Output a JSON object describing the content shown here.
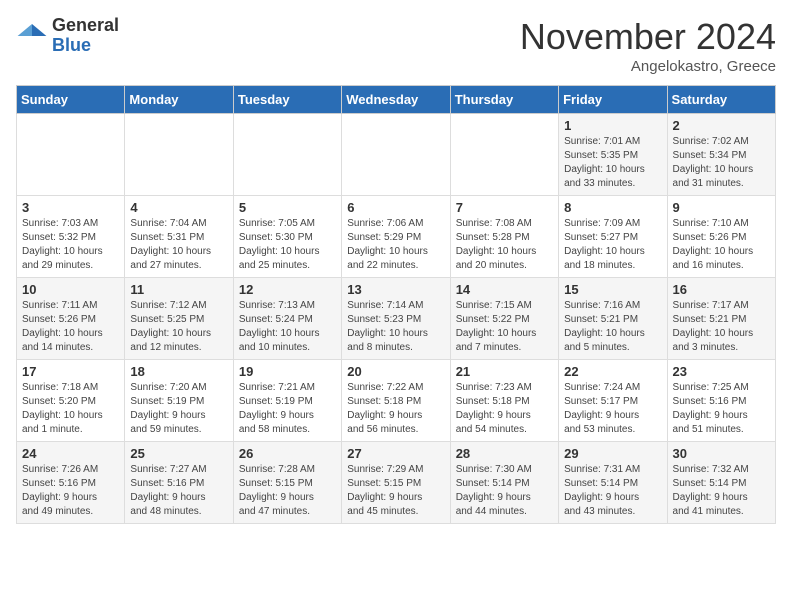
{
  "header": {
    "logo_general": "General",
    "logo_blue": "Blue",
    "month_title": "November 2024",
    "location": "Angelokastro, Greece"
  },
  "weekdays": [
    "Sunday",
    "Monday",
    "Tuesday",
    "Wednesday",
    "Thursday",
    "Friday",
    "Saturday"
  ],
  "weeks": [
    [
      {
        "day": "",
        "info": ""
      },
      {
        "day": "",
        "info": ""
      },
      {
        "day": "",
        "info": ""
      },
      {
        "day": "",
        "info": ""
      },
      {
        "day": "",
        "info": ""
      },
      {
        "day": "1",
        "info": "Sunrise: 7:01 AM\nSunset: 5:35 PM\nDaylight: 10 hours\nand 33 minutes."
      },
      {
        "day": "2",
        "info": "Sunrise: 7:02 AM\nSunset: 5:34 PM\nDaylight: 10 hours\nand 31 minutes."
      }
    ],
    [
      {
        "day": "3",
        "info": "Sunrise: 7:03 AM\nSunset: 5:32 PM\nDaylight: 10 hours\nand 29 minutes."
      },
      {
        "day": "4",
        "info": "Sunrise: 7:04 AM\nSunset: 5:31 PM\nDaylight: 10 hours\nand 27 minutes."
      },
      {
        "day": "5",
        "info": "Sunrise: 7:05 AM\nSunset: 5:30 PM\nDaylight: 10 hours\nand 25 minutes."
      },
      {
        "day": "6",
        "info": "Sunrise: 7:06 AM\nSunset: 5:29 PM\nDaylight: 10 hours\nand 22 minutes."
      },
      {
        "day": "7",
        "info": "Sunrise: 7:08 AM\nSunset: 5:28 PM\nDaylight: 10 hours\nand 20 minutes."
      },
      {
        "day": "8",
        "info": "Sunrise: 7:09 AM\nSunset: 5:27 PM\nDaylight: 10 hours\nand 18 minutes."
      },
      {
        "day": "9",
        "info": "Sunrise: 7:10 AM\nSunset: 5:26 PM\nDaylight: 10 hours\nand 16 minutes."
      }
    ],
    [
      {
        "day": "10",
        "info": "Sunrise: 7:11 AM\nSunset: 5:26 PM\nDaylight: 10 hours\nand 14 minutes."
      },
      {
        "day": "11",
        "info": "Sunrise: 7:12 AM\nSunset: 5:25 PM\nDaylight: 10 hours\nand 12 minutes."
      },
      {
        "day": "12",
        "info": "Sunrise: 7:13 AM\nSunset: 5:24 PM\nDaylight: 10 hours\nand 10 minutes."
      },
      {
        "day": "13",
        "info": "Sunrise: 7:14 AM\nSunset: 5:23 PM\nDaylight: 10 hours\nand 8 minutes."
      },
      {
        "day": "14",
        "info": "Sunrise: 7:15 AM\nSunset: 5:22 PM\nDaylight: 10 hours\nand 7 minutes."
      },
      {
        "day": "15",
        "info": "Sunrise: 7:16 AM\nSunset: 5:21 PM\nDaylight: 10 hours\nand 5 minutes."
      },
      {
        "day": "16",
        "info": "Sunrise: 7:17 AM\nSunset: 5:21 PM\nDaylight: 10 hours\nand 3 minutes."
      }
    ],
    [
      {
        "day": "17",
        "info": "Sunrise: 7:18 AM\nSunset: 5:20 PM\nDaylight: 10 hours\nand 1 minute."
      },
      {
        "day": "18",
        "info": "Sunrise: 7:20 AM\nSunset: 5:19 PM\nDaylight: 9 hours\nand 59 minutes."
      },
      {
        "day": "19",
        "info": "Sunrise: 7:21 AM\nSunset: 5:19 PM\nDaylight: 9 hours\nand 58 minutes."
      },
      {
        "day": "20",
        "info": "Sunrise: 7:22 AM\nSunset: 5:18 PM\nDaylight: 9 hours\nand 56 minutes."
      },
      {
        "day": "21",
        "info": "Sunrise: 7:23 AM\nSunset: 5:18 PM\nDaylight: 9 hours\nand 54 minutes."
      },
      {
        "day": "22",
        "info": "Sunrise: 7:24 AM\nSunset: 5:17 PM\nDaylight: 9 hours\nand 53 minutes."
      },
      {
        "day": "23",
        "info": "Sunrise: 7:25 AM\nSunset: 5:16 PM\nDaylight: 9 hours\nand 51 minutes."
      }
    ],
    [
      {
        "day": "24",
        "info": "Sunrise: 7:26 AM\nSunset: 5:16 PM\nDaylight: 9 hours\nand 49 minutes."
      },
      {
        "day": "25",
        "info": "Sunrise: 7:27 AM\nSunset: 5:16 PM\nDaylight: 9 hours\nand 48 minutes."
      },
      {
        "day": "26",
        "info": "Sunrise: 7:28 AM\nSunset: 5:15 PM\nDaylight: 9 hours\nand 47 minutes."
      },
      {
        "day": "27",
        "info": "Sunrise: 7:29 AM\nSunset: 5:15 PM\nDaylight: 9 hours\nand 45 minutes."
      },
      {
        "day": "28",
        "info": "Sunrise: 7:30 AM\nSunset: 5:14 PM\nDaylight: 9 hours\nand 44 minutes."
      },
      {
        "day": "29",
        "info": "Sunrise: 7:31 AM\nSunset: 5:14 PM\nDaylight: 9 hours\nand 43 minutes."
      },
      {
        "day": "30",
        "info": "Sunrise: 7:32 AM\nSunset: 5:14 PM\nDaylight: 9 hours\nand 41 minutes."
      }
    ]
  ]
}
